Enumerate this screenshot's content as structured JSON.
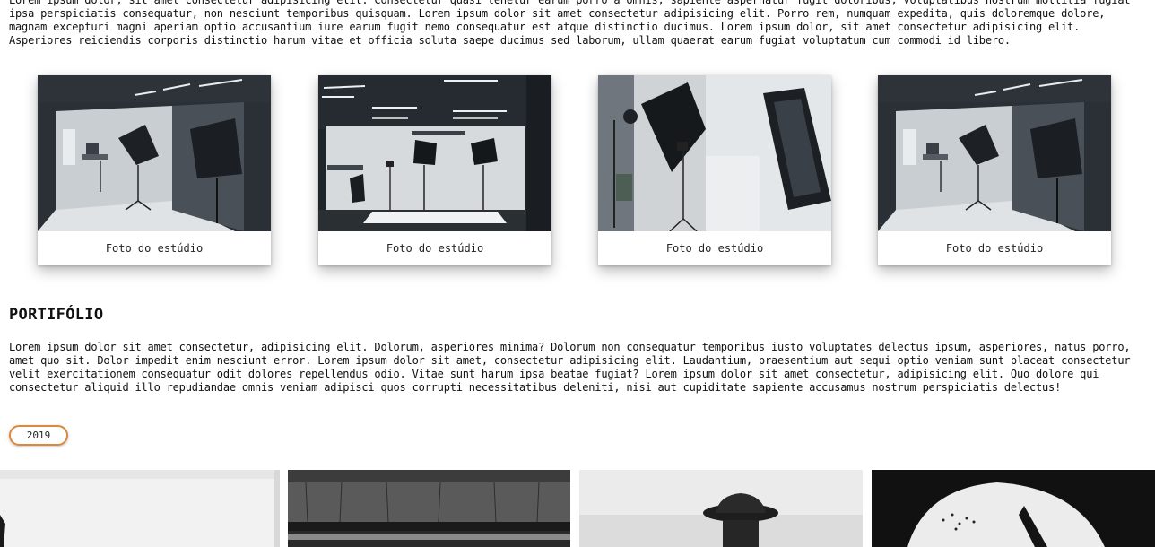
{
  "intro": {
    "text": "Lorem ipsum dolor, sit amet consectetur adipisicing elit. Consectetur quasi tenetur earum porro a omnis, sapiente aspernatur fugit doloribus, voluptatibus nostrum mollitia fugiat ipsa perspiciatis consequatur, non nesciunt temporibus quisquam. Lorem ipsum dolor sit amet consectetur adipisicing elit. Porro rem, numquam expedita, quis doloremque dolore, magnam excepturi magni aperiam optio accusantium iure earum fugit nemo consequatur est atque distinctio ducimus. Lorem ipsum dolor, sit amet consectetur adipisicing elit. Asperiores reiciendis corporis distinctio harum vitae et officia soluta saepe ducimus sed laborum, ullam quaerat earum fugiat voluptatum cum commodi id libero."
  },
  "studio_gallery": {
    "cards": [
      {
        "caption": "Foto do estúdio"
      },
      {
        "caption": "Foto do estúdio"
      },
      {
        "caption": "Foto do estúdio"
      },
      {
        "caption": "Foto do estúdio"
      }
    ]
  },
  "portfolio": {
    "title": "PORTIFÓLIO",
    "text": "Lorem ipsum dolor sit amet consectetur, adipisicing elit. Dolorum, asperiores minima? Dolorum non consequatur temporibus iusto voluptates delectus ipsum, asperiores, natus porro, amet quo sit. Dolor impedit enim nesciunt error. Lorem ipsum dolor sit amet, consectetur adipisicing elit. Laudantium, praesentium aut sequi optio veniam sunt placeat consectetur velit exercitationem consequatur odit dolores repellendus odio. Vitae sunt harum ipsa beatae fugiat? Lorem ipsum dolor sit amet consectetur, adipisicing elit. Quo dolore qui consectetur aliquid illo repudiandae omnis veniam adipisci quos corrupti necessitatibus deleniti, nisi aut cupiditate sapiente accusamus nostrum perspiciatis delectus!",
    "year_button": "2019"
  },
  "colors": {
    "accent": "#d98a3a",
    "text": "#111111"
  }
}
